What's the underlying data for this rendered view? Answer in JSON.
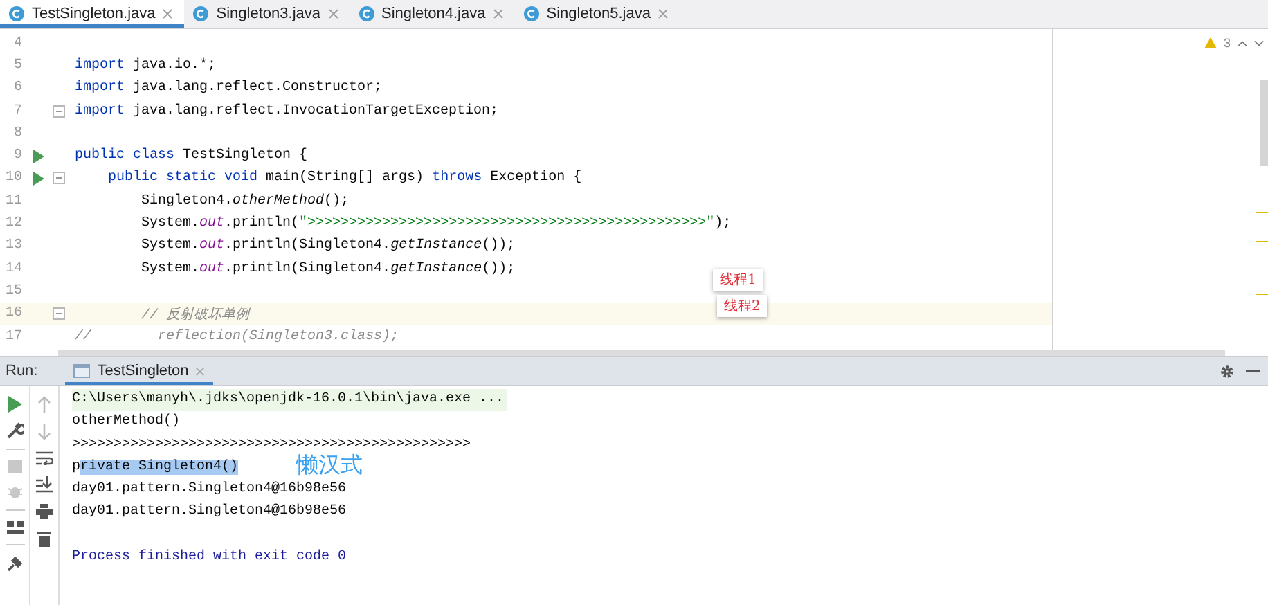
{
  "tabs": [
    {
      "label": "TestSingleton.java",
      "selected": true
    },
    {
      "label": "Singleton3.java",
      "selected": false
    },
    {
      "label": "Singleton4.java",
      "selected": false
    },
    {
      "label": "Singleton5.java",
      "selected": false
    }
  ],
  "editor": {
    "inspections": {
      "count": "3"
    },
    "lines": [
      {
        "number": "4",
        "run": false,
        "fold": false,
        "current": false
      },
      {
        "number": "5",
        "run": false,
        "fold": false,
        "current": false,
        "tokens": [
          {
            "kind": "keyword",
            "text": "import"
          },
          {
            "kind": "plain",
            "text": " java.io.*;"
          }
        ]
      },
      {
        "number": "6",
        "run": false,
        "fold": false,
        "current": false,
        "tokens": [
          {
            "kind": "keyword",
            "text": "import"
          },
          {
            "kind": "plain",
            "text": " java.lang.reflect.Constructor;"
          }
        ]
      },
      {
        "number": "7",
        "run": false,
        "fold": true,
        "current": false,
        "tokens": [
          {
            "kind": "keyword",
            "text": "import"
          },
          {
            "kind": "plain",
            "text": " java.lang.reflect.InvocationTargetException;"
          }
        ]
      },
      {
        "number": "8",
        "run": false,
        "fold": false,
        "current": false
      },
      {
        "number": "9",
        "run": true,
        "fold": false,
        "current": false,
        "tokens": [
          {
            "kind": "keyword",
            "text": "public class"
          },
          {
            "kind": "plain",
            "text": " TestSingleton {"
          }
        ]
      },
      {
        "number": "10",
        "run": true,
        "fold": true,
        "current": false,
        "tokens": [
          {
            "kind": "keyword",
            "text": "    public static void"
          },
          {
            "kind": "plain",
            "text": " main(String[] args) "
          },
          {
            "kind": "keyword",
            "text": "throws"
          },
          {
            "kind": "plain",
            "text": " Exception {"
          }
        ]
      },
      {
        "number": "11",
        "run": false,
        "fold": false,
        "current": false,
        "tokens": [
          {
            "kind": "plain",
            "text": "        Singleton4."
          },
          {
            "kind": "italic",
            "text": "otherMethod"
          },
          {
            "kind": "plain",
            "text": "();"
          }
        ]
      },
      {
        "number": "12",
        "run": false,
        "fold": false,
        "current": false,
        "tokens": [
          {
            "kind": "plain",
            "text": "        System."
          },
          {
            "kind": "field",
            "text": "out"
          },
          {
            "kind": "plain",
            "text": ".println("
          },
          {
            "kind": "string",
            "text": "\">>>>>>>>>>>>>>>>>>>>>>>>>>>>>>>>>>>>>>>>>>>>>>>>\""
          },
          {
            "kind": "plain",
            "text": ");"
          }
        ]
      },
      {
        "number": "13",
        "run": false,
        "fold": false,
        "current": false,
        "tokens": [
          {
            "kind": "plain",
            "text": "        System."
          },
          {
            "kind": "field",
            "text": "out"
          },
          {
            "kind": "plain",
            "text": ".println(Singleton4."
          },
          {
            "kind": "italic",
            "text": "getInstance"
          },
          {
            "kind": "plain",
            "text": "());"
          }
        ]
      },
      {
        "number": "14",
        "run": false,
        "fold": false,
        "current": false,
        "tokens": [
          {
            "kind": "plain",
            "text": "        System."
          },
          {
            "kind": "field",
            "text": "out"
          },
          {
            "kind": "plain",
            "text": ".println(Singleton4."
          },
          {
            "kind": "italic",
            "text": "getInstance"
          },
          {
            "kind": "plain",
            "text": "());"
          }
        ]
      },
      {
        "number": "15",
        "run": false,
        "fold": false,
        "current": false
      },
      {
        "number": "16",
        "run": false,
        "fold": true,
        "current": true,
        "tokens": [
          {
            "kind": "comment",
            "text": "        // 反射破坏单例"
          }
        ]
      },
      {
        "number": "17",
        "run": false,
        "fold": false,
        "current": false,
        "tokens": [
          {
            "kind": "comment",
            "text": "//        reflection(Singleton3.class);"
          }
        ]
      }
    ]
  },
  "annotations": [
    {
      "text": "线程1"
    },
    {
      "text": "线程2"
    }
  ],
  "run_panel": {
    "label": "Run:",
    "tabs": [
      {
        "label": "TestSingleton",
        "selected": true
      }
    ],
    "output": [
      {
        "kind": "command",
        "segments": [
          {
            "text": "C:\\Users\\manyh\\.jdks\\openjdk-16.0.1\\bin\\java.exe ...",
            "selected": false
          }
        ]
      },
      {
        "kind": "plain",
        "segments": [
          {
            "text": "otherMethod()",
            "selected": false
          }
        ]
      },
      {
        "kind": "plain",
        "segments": [
          {
            "text": ">>>>>>>>>>>>>>>>>>>>>>>>>>>>>>>>>>>>>>>>>>>>>>>>",
            "selected": false
          }
        ]
      },
      {
        "kind": "plain",
        "segments": [
          {
            "text": "p",
            "selected": false
          },
          {
            "text": "rivate Singleton4()",
            "selected": true
          }
        ]
      },
      {
        "kind": "plain",
        "segments": [
          {
            "text": "day01.pattern.Singleton4@16b98e56",
            "selected": false
          }
        ]
      },
      {
        "kind": "plain",
        "segments": [
          {
            "text": "day01.pattern.Singleton4@16b98e56",
            "selected": false
          }
        ]
      },
      {
        "kind": "exit",
        "segments": [
          {
            "text": "Process finished with exit code 0",
            "selected": false
          }
        ]
      }
    ],
    "note": "懒汉式"
  }
}
